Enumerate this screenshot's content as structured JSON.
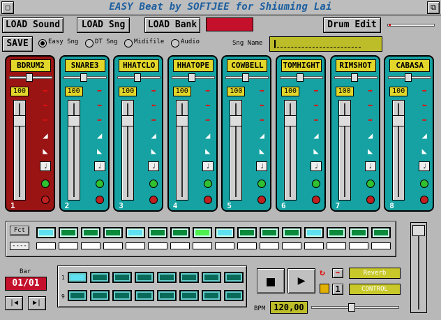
{
  "window": {
    "title": "EASY Beat by SOFTJEE for Shiuming Lai",
    "close_glyph": "□",
    "depth_glyph": "⧉"
  },
  "toolbar": {
    "load_sound": "LOAD Sound",
    "load_sng": "LOAD Sng",
    "load_bank": "LOAD Bank",
    "save": "SAVE",
    "drum_edit": "Drum Edit"
  },
  "modes": [
    {
      "label": "Easy Sng",
      "selected": true
    },
    {
      "label": "DT Sng",
      "selected": false
    },
    {
      "label": "Midifile",
      "selected": false
    },
    {
      "label": "Audio",
      "selected": false
    }
  ],
  "song": {
    "name_label": "Sng Name",
    "name_value": ""
  },
  "channels": [
    {
      "name": "BDRUM2",
      "volume": "100",
      "number": "1",
      "selected": true
    },
    {
      "name": "SNARE3",
      "volume": "100",
      "number": "2",
      "selected": false
    },
    {
      "name": "HHATCLO",
      "volume": "100",
      "number": "3",
      "selected": false
    },
    {
      "name": "HHATOPE",
      "volume": "100",
      "number": "4",
      "selected": false
    },
    {
      "name": "COWBELL",
      "volume": "100",
      "number": "5",
      "selected": false
    },
    {
      "name": "TOMHIGHT",
      "volume": "100",
      "number": "6",
      "selected": false
    },
    {
      "name": "RIMSHOT",
      "volume": "100",
      "number": "7",
      "selected": false
    },
    {
      "name": "CABASA",
      "volume": "100",
      "number": "8",
      "selected": false
    }
  ],
  "pattern": {
    "fct_label": "Fct",
    "blank_label": "----",
    "step_colors": [
      "cyan",
      "green",
      "green",
      "green",
      "cyan",
      "green",
      "green",
      "lime",
      "cyan",
      "green",
      "green",
      "green",
      "cyan",
      "green",
      "green",
      "green"
    ]
  },
  "bar": {
    "label": "Bar",
    "value": "01/01",
    "row1_label": "1",
    "row2_label": "9"
  },
  "sequence": {
    "row1": [
      "cyan",
      "g",
      "g",
      "g",
      "g",
      "g",
      "g",
      "g"
    ],
    "row2": [
      "g",
      "g",
      "g",
      "g",
      "g",
      "g",
      "g",
      "g"
    ]
  },
  "transport": {
    "reverb": "Reverb",
    "control": "CONTROL",
    "bpm_label": "BPM",
    "bpm_value": "120,00",
    "count": "1"
  },
  "icons": {
    "arrow_right": "➡",
    "arrow_left": "⬅",
    "stop": "■",
    "play": "▶",
    "prev": "|◀",
    "next": "▶|"
  }
}
